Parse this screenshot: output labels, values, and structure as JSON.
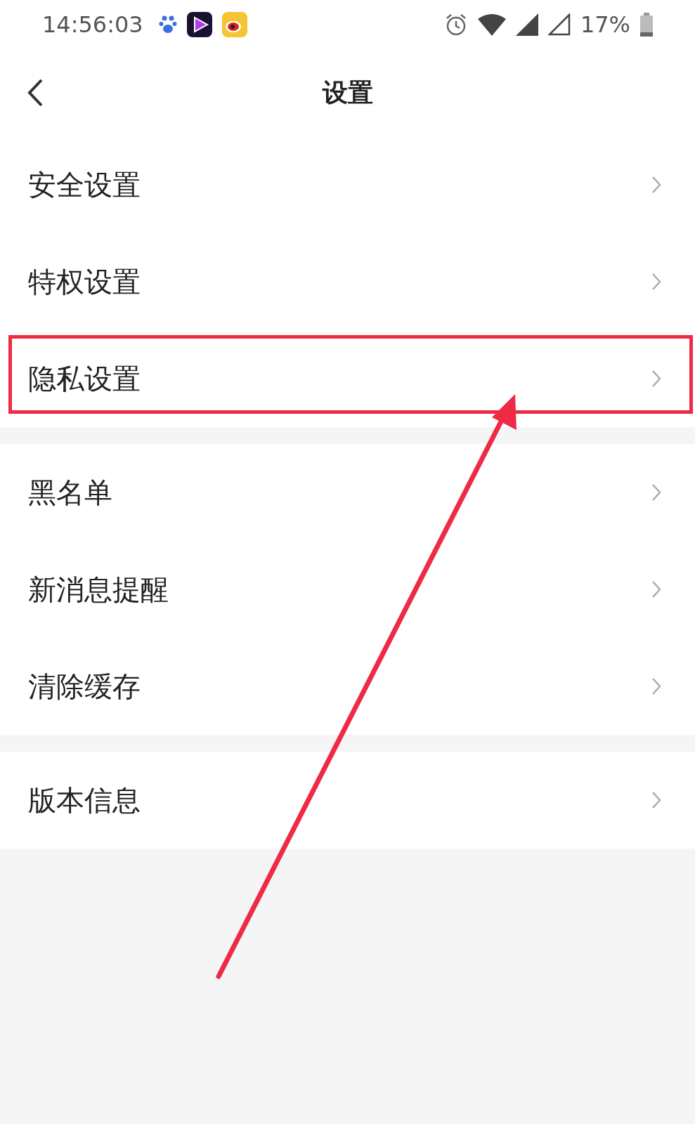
{
  "status_bar": {
    "time": "14:56:03",
    "battery": "17%"
  },
  "header": {
    "title": "设置"
  },
  "groups": [
    {
      "items": [
        {
          "label": "安全设置",
          "highlighted": false
        },
        {
          "label": "特权设置",
          "highlighted": false
        },
        {
          "label": "隐私设置",
          "highlighted": true
        }
      ]
    },
    {
      "items": [
        {
          "label": "黑名单",
          "highlighted": false
        },
        {
          "label": "新消息提醒",
          "highlighted": false
        },
        {
          "label": "清除缓存",
          "highlighted": false
        }
      ]
    },
    {
      "items": [
        {
          "label": "版本信息",
          "highlighted": false
        }
      ]
    }
  ]
}
